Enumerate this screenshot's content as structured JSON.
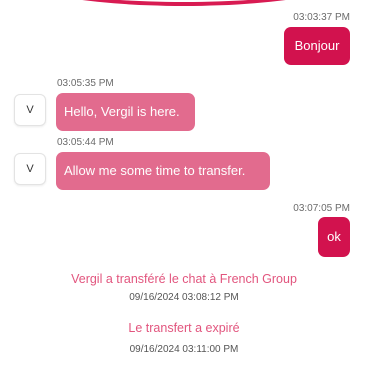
{
  "messages": [
    {
      "direction": "out",
      "time": "03:03:37 PM",
      "text": "Bonjour"
    },
    {
      "direction": "in",
      "time": "03:05:35 PM",
      "avatar": "V",
      "text": "Hello, Vergil is here."
    },
    {
      "direction": "in",
      "time": "03:05:44 PM",
      "avatar": "V",
      "text": "Allow me some time to transfer."
    },
    {
      "direction": "out",
      "time": "03:07:05 PM",
      "text": "ok"
    }
  ],
  "system_events": [
    {
      "text": "Vergil a transféré le chat à French Group",
      "timestamp": "09/16/2024 03:08:12 PM"
    },
    {
      "text": "Le transfert a expiré",
      "timestamp": "09/16/2024 03:11:00 PM"
    }
  ],
  "colors": {
    "outgoing_bubble": "#d2124e",
    "incoming_bubble": "#e26b8e",
    "system_text": "#e2557e"
  }
}
